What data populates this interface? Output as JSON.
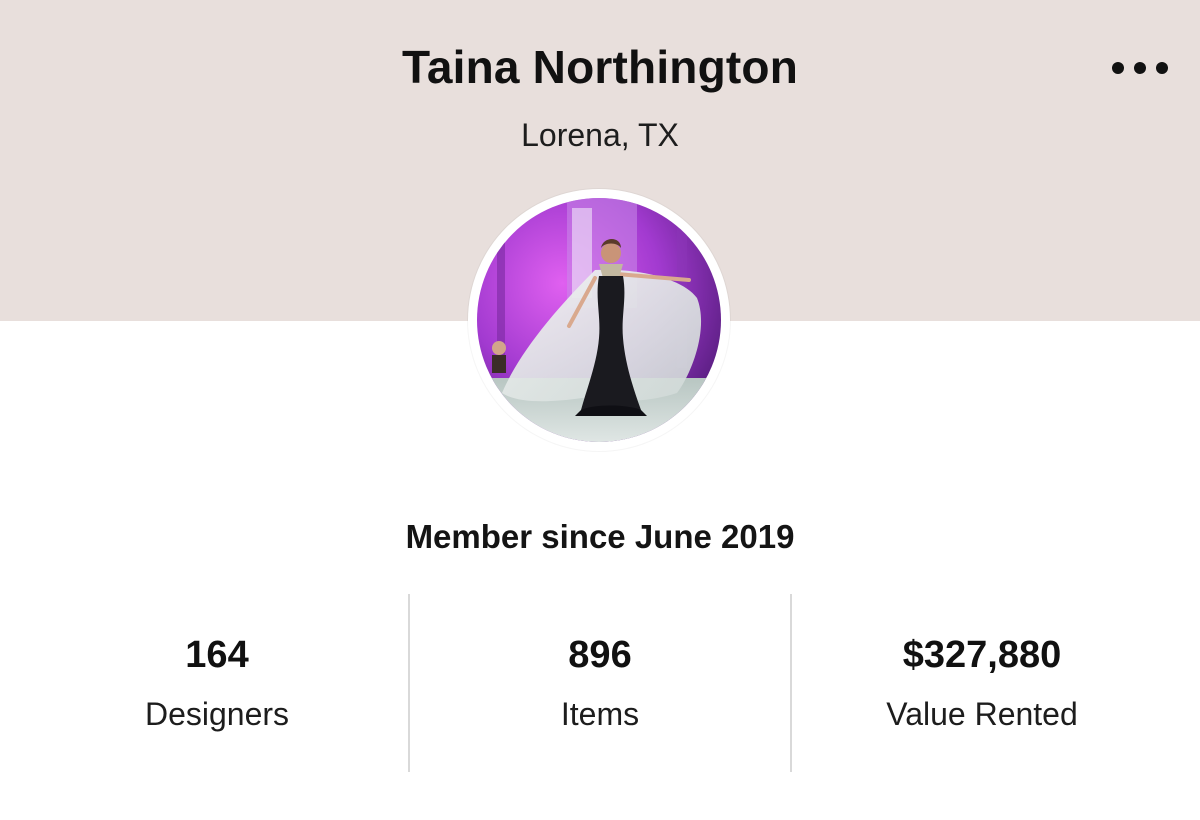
{
  "profile": {
    "name": "Taina Northington",
    "location": "Lorena, TX",
    "member_since": "Member since June 2019",
    "avatar_icon": "profile-photo",
    "more_icon": "more-dots-icon"
  },
  "stats": [
    {
      "value": "164",
      "label": "Designers"
    },
    {
      "value": "896",
      "label": "Items"
    },
    {
      "value": "$327,880",
      "label": "Value Rented"
    }
  ],
  "colors": {
    "header_background": "#e8dfdc",
    "text": "#111111",
    "divider": "#d9d9d9"
  }
}
